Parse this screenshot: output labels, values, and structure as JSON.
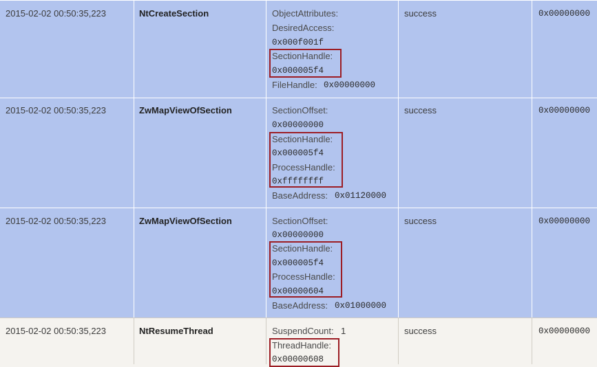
{
  "rows": [
    {
      "time": "2015-02-02 00:50:35,223",
      "function": "NtCreateSection",
      "params": {
        "object_attributes": "ObjectAttributes:",
        "desired_access": "DesiredAccess:",
        "desired_access_value": "0x000f001f",
        "section_handle": "SectionHandle:",
        "section_handle_value": "0x000005f4",
        "file_handle": "FileHandle:",
        "file_handle_value": "0x00000000"
      },
      "status": "success",
      "return": "0x00000000"
    },
    {
      "time": "2015-02-02 00:50:35,223",
      "function": "ZwMapViewOfSection",
      "params": {
        "section_offset": "SectionOffset:",
        "section_offset_value": "0x00000000",
        "section_handle": "SectionHandle:",
        "section_handle_value": "0x000005f4",
        "process_handle": "ProcessHandle:",
        "process_handle_value": "0xffffffff",
        "base_address": "BaseAddress:",
        "base_address_value": "0x01120000"
      },
      "status": "success",
      "return": "0x00000000"
    },
    {
      "time": "2015-02-02 00:50:35,223",
      "function": "ZwMapViewOfSection",
      "params": {
        "section_offset": "SectionOffset:",
        "section_offset_value": "0x00000000",
        "section_handle": "SectionHandle:",
        "section_handle_value": "0x000005f4",
        "process_handle": "ProcessHandle:",
        "process_handle_value": "0x00000604",
        "base_address": "BaseAddress:",
        "base_address_value": "0x01000000"
      },
      "status": "success",
      "return": "0x00000000"
    },
    {
      "time": "2015-02-02 00:50:35,223",
      "function": "NtResumeThread",
      "params": {
        "suspend_count": "SuspendCount:",
        "suspend_count_value": "1",
        "thread_handle": "ThreadHandle:",
        "thread_handle_value": "0x00000608"
      },
      "status": "success",
      "return": "0x00000000"
    }
  ],
  "colors": {
    "selected_row": "#b2c4ee",
    "normal_row": "#f5f3ef",
    "highlight_box": "#9c1d24"
  }
}
